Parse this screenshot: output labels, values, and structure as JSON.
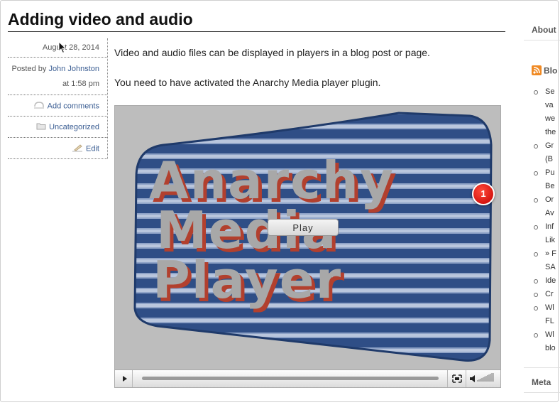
{
  "post": {
    "title": "Adding video and audio",
    "date": "August 28, 2014",
    "posted_by_prefix": "Posted by",
    "author": "John Johnston",
    "time": "at 1:58 pm",
    "add_comments": "Add comments",
    "category": "Uncategorized",
    "edit": "Edit",
    "paragraph1": "Video and audio files can be displayed in players in a blog post or page.",
    "paragraph2": "You need to have activated the Anarchy Media player plugin."
  },
  "player": {
    "logo_line1": "Anarchy",
    "logo_line2": "Media",
    "logo_line3": "Player",
    "play_label": "Play"
  },
  "annotation": {
    "badge_number": "1"
  },
  "sidebar": {
    "heading_about": "About",
    "heading_blogroll": "Blo",
    "heading_meta": "Meta",
    "items": [
      "Se",
      "va",
      "we",
      "the",
      "Gr",
      "(B",
      "Pu",
      "Be",
      "Or",
      "Av",
      "Inf",
      "Lik",
      "» F",
      "SA",
      "Ide",
      "Cr",
      "Wl",
      "FL",
      "Wl",
      "blo"
    ]
  },
  "colors": {
    "link": "#3a5d92",
    "logo_blue": "#2f4e86",
    "logo_text": "#a8a8a8",
    "logo_shadow": "#b2402e",
    "badge": "#d40000"
  }
}
